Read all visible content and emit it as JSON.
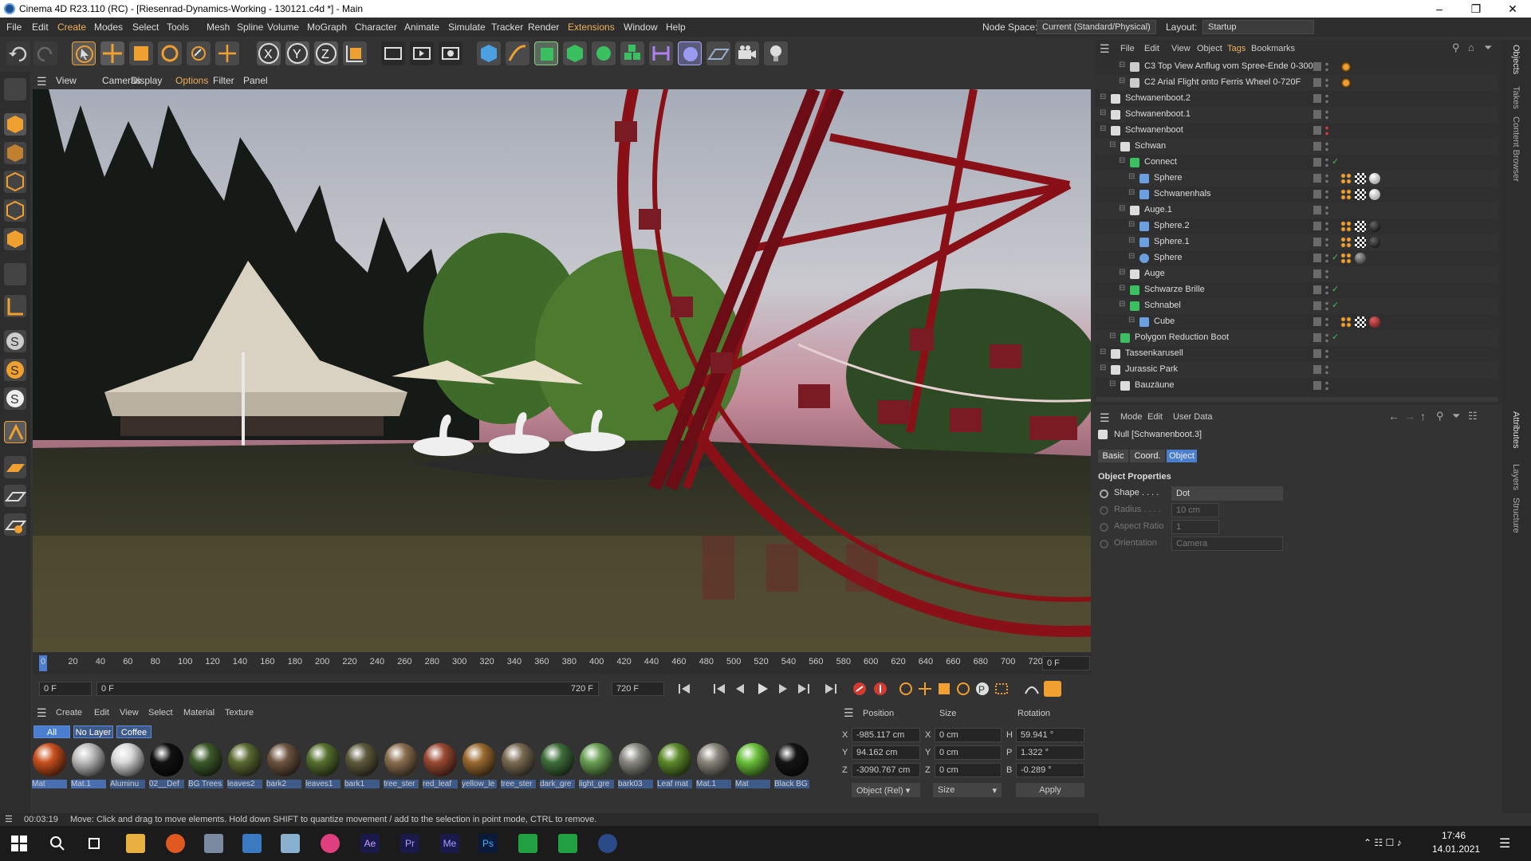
{
  "window": {
    "title": "Cinema 4D R23.110 (RC) - [Riesenrad-Dynamics-Working - 130121.c4d *] - Main"
  },
  "menu": [
    "File",
    "Edit",
    "Create",
    "Modes",
    "Select",
    "Tools",
    "Mesh",
    "Spline",
    "Volume",
    "MoGraph",
    "Character",
    "Animate",
    "Simulate",
    "Tracker",
    "Render",
    "Extensions",
    "Window",
    "Help"
  ],
  "nodespace": {
    "label": "Node Space:",
    "value": "Current (Standard/Physical)"
  },
  "layout": {
    "label": "Layout:",
    "value": "Startup"
  },
  "viewport_menu": [
    "View",
    "Cameras",
    "Display",
    "Options",
    "Filter",
    "Panel"
  ],
  "timeline": {
    "ticks": [
      "0",
      "20",
      "40",
      "60",
      "80",
      "100",
      "120",
      "140",
      "160",
      "180",
      "200",
      "220",
      "240",
      "260",
      "280",
      "300",
      "320",
      "340",
      "360",
      "380",
      "400",
      "420",
      "440",
      "460",
      "480",
      "500",
      "520",
      "540",
      "560",
      "580",
      "600",
      "620",
      "640",
      "660",
      "680",
      "700",
      "720"
    ],
    "current_frame": "0 F",
    "start": "0 F",
    "start2": "0 F",
    "end": "720 F",
    "end2": "720 F"
  },
  "material_panel": {
    "menu": [
      "Create",
      "Edit",
      "View",
      "Select",
      "Material",
      "Texture"
    ],
    "layers": [
      "All",
      "No Layer",
      "Coffee"
    ],
    "materials": [
      {
        "name": "Mat",
        "color": "#c8501e"
      },
      {
        "name": "Mat.1",
        "color": "#bdbdbd"
      },
      {
        "name": "Aluminu",
        "color": "#d9d9d9"
      },
      {
        "name": "02__Def",
        "color": "#111111"
      },
      {
        "name": "BG Trees",
        "color": "#3d5a2a"
      },
      {
        "name": "leaves2",
        "color": "#5b6a32"
      },
      {
        "name": "bark2",
        "color": "#6d5440"
      },
      {
        "name": "leaves1",
        "color": "#56702e"
      },
      {
        "name": "bark1",
        "color": "#5e5a3c"
      },
      {
        "name": "tree_ster",
        "color": "#8a6e4e"
      },
      {
        "name": "red_leaf",
        "color": "#9a4a32"
      },
      {
        "name": "yellow_le",
        "color": "#9a6a30"
      },
      {
        "name": "tree_ster",
        "color": "#7a6a52"
      },
      {
        "name": "dark_gre",
        "color": "#3e6e3a"
      },
      {
        "name": "light_gre",
        "color": "#6aa054"
      },
      {
        "name": "bark03",
        "color": "#8a8a82"
      },
      {
        "name": "Leaf mat",
        "color": "#5c8a2a"
      },
      {
        "name": "Mat.1",
        "color": "#8a867c"
      },
      {
        "name": "Mat",
        "color": "#6ac03a"
      },
      {
        "name": "Black BG",
        "color": "#151515"
      }
    ]
  },
  "coords": {
    "headers": [
      "Position",
      "Size",
      "Rotation"
    ],
    "rows": [
      {
        "axis": "X",
        "pos": "-985.117 cm",
        "saxis": "X",
        "size": "0 cm",
        "raxis": "H",
        "rot": "59.941 °"
      },
      {
        "axis": "Y",
        "pos": "94.162 cm",
        "saxis": "Y",
        "size": "0 cm",
        "raxis": "P",
        "rot": "1.322 °"
      },
      {
        "axis": "Z",
        "pos": "-3090.767 cm",
        "saxis": "Z",
        "size": "0 cm",
        "raxis": "B",
        "rot": "-0.289 °"
      }
    ],
    "mode": "Object (Rel)",
    "size_mode": "Size",
    "apply": "Apply"
  },
  "object_manager": {
    "menu": [
      "File",
      "Edit",
      "View",
      "Object",
      "Tags",
      "Bookmarks"
    ],
    "items": [
      {
        "name": "C3 Top View Anflug vom Spree-Ende 0-300F",
        "indent": 2,
        "icon": "camera",
        "tags": [
          "orange"
        ]
      },
      {
        "name": "C2 Arial Flight onto Ferris Wheel 0-720F",
        "indent": 2,
        "icon": "camera",
        "tags": [
          "orange"
        ]
      },
      {
        "name": "Schwanenboot.2",
        "indent": 0,
        "icon": "null",
        "tags": []
      },
      {
        "name": "Schwanenboot.1",
        "indent": 0,
        "icon": "null",
        "tags": []
      },
      {
        "name": "Schwanenboot",
        "indent": 0,
        "icon": "null",
        "tags": [],
        "red": true
      },
      {
        "name": "Schwan",
        "indent": 1,
        "icon": "null",
        "tags": []
      },
      {
        "name": "Connect",
        "indent": 2,
        "icon": "green",
        "tags": [],
        "check": true
      },
      {
        "name": "Sphere",
        "indent": 3,
        "icon": "poly",
        "tags": [
          "dots",
          "checker",
          "white"
        ]
      },
      {
        "name": "Schwanenhals",
        "indent": 3,
        "icon": "poly",
        "tags": [
          "dots",
          "checker",
          "white"
        ]
      },
      {
        "name": "Auge.1",
        "indent": 2,
        "icon": "null",
        "tags": []
      },
      {
        "name": "Sphere.2",
        "indent": 3,
        "icon": "poly",
        "tags": [
          "dots",
          "checker",
          "black"
        ]
      },
      {
        "name": "Sphere.1",
        "indent": 3,
        "icon": "poly",
        "tags": [
          "dots",
          "checker",
          "black"
        ]
      },
      {
        "name": "Sphere",
        "indent": 3,
        "icon": "sphere",
        "tags": [
          "dots",
          "dark"
        ],
        "check": true
      },
      {
        "name": "Auge",
        "indent": 2,
        "icon": "null",
        "tags": []
      },
      {
        "name": "Schwarze Brille",
        "indent": 2,
        "icon": "greenpoly",
        "tags": [],
        "check": true
      },
      {
        "name": "Schnabel",
        "indent": 2,
        "icon": "greenobj",
        "tags": [],
        "check": true
      },
      {
        "name": "Cube",
        "indent": 3,
        "icon": "poly",
        "tags": [
          "dots",
          "checker",
          "red"
        ]
      },
      {
        "name": "Polygon Reduction Boot",
        "indent": 1,
        "icon": "greenpoly",
        "tags": [],
        "check": true
      },
      {
        "name": "Tassenkarusell",
        "indent": 0,
        "icon": "null",
        "tags": []
      },
      {
        "name": "Jurassic Park",
        "indent": 0,
        "icon": "null",
        "tags": []
      },
      {
        "name": "Bauzäune",
        "indent": 1,
        "icon": "null",
        "tags": []
      }
    ]
  },
  "attributes": {
    "menu": [
      "Mode",
      "Edit",
      "User Data"
    ],
    "object_label": "Null [Schwanenboot.3]",
    "tabs": [
      "Basic",
      "Coord.",
      "Object"
    ],
    "section": "Object Properties",
    "props": [
      {
        "label": "Shape . . . .",
        "value": "Dot",
        "enabled": true
      },
      {
        "label": "Radius . . . .",
        "value": "10 cm",
        "enabled": false
      },
      {
        "label": "Aspect Ratio",
        "value": "1",
        "enabled": false
      },
      {
        "label": "Orientation",
        "value": "Camera",
        "enabled": false
      }
    ]
  },
  "right_tabs": [
    "Objects",
    "Takes",
    "Content Browser",
    "Attributes",
    "Layers",
    "Structure"
  ],
  "status": {
    "time": "00:03:19",
    "message": "Move: Click and drag to move elements. Hold down SHIFT to quantize movement / add to the selection in point mode, CTRL to remove."
  },
  "taskbar": {
    "time": "17:46",
    "date": "14.01.2021"
  },
  "colors": {
    "accent": "#f0a030",
    "selection": "#4a7fd0",
    "bg": "#333333"
  }
}
